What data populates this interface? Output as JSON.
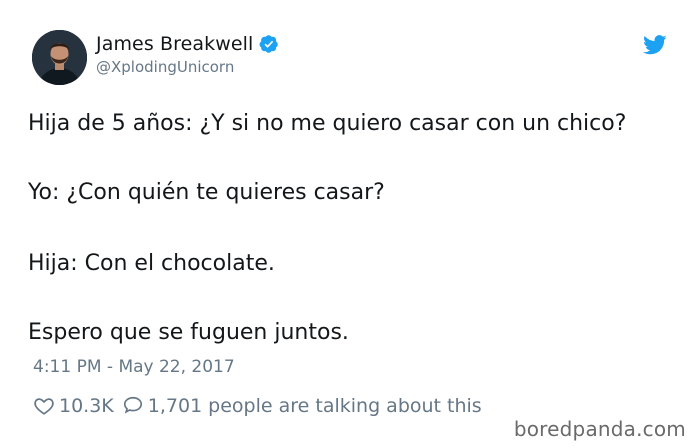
{
  "tweet": {
    "author_name": "James Breakwell",
    "author_handle": "@XplodingUnicorn",
    "lines": [
      "Hija de 5 años: ¿Y si no me quiero casar con un chico?",
      "Yo: ¿Con quién te quieres casar?",
      "Hija: Con el chocolate.",
      "Espero que se fuguen juntos."
    ],
    "timestamp": "4:11 PM - May 22, 2017",
    "like_count": "10.3K",
    "reply_count": "1,701",
    "reply_text": "people are talking about this"
  },
  "watermark": "boredpanda.com",
  "icons": {
    "avatar": "avatar",
    "verified": "verified-badge-icon",
    "bird": "twitter-bird-icon",
    "heart": "heart-icon",
    "bubble": "comment-bubble-icon"
  },
  "colors": {
    "twitter_blue": "#1da1f2",
    "text_primary": "#14171a",
    "text_secondary": "#657786"
  }
}
